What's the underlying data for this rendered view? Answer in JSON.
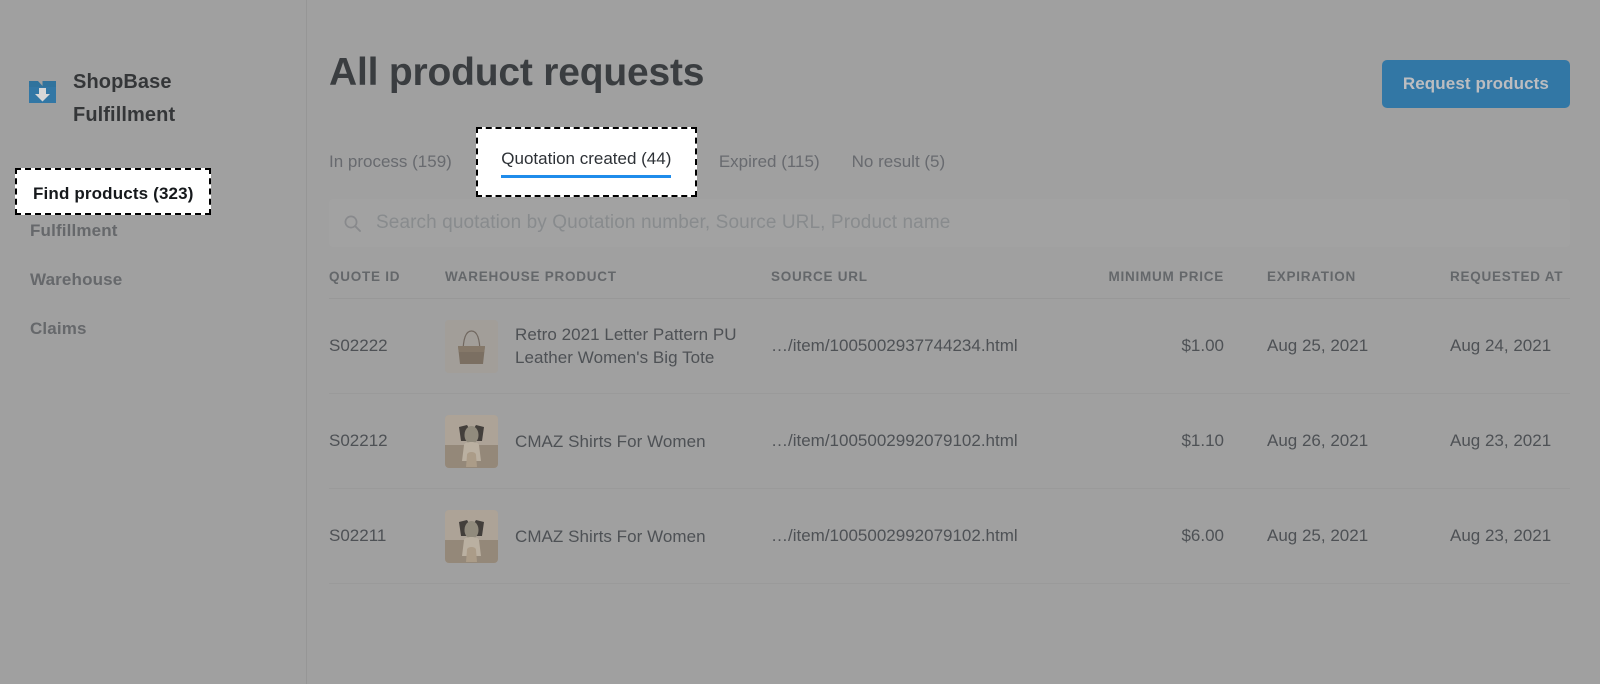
{
  "sidebar": {
    "brand": {
      "logo_icon": "box-download-icon",
      "line1": "ShopBase",
      "line2": "Fulfillment"
    },
    "items": [
      {
        "label": "Find products (323)",
        "active": true
      },
      {
        "label": "Fulfillment",
        "active": false
      },
      {
        "label": "Warehouse",
        "active": false
      },
      {
        "label": "Claims",
        "active": false
      }
    ]
  },
  "header": {
    "title": "All product requests",
    "primary_button": "Request products"
  },
  "tabs": [
    {
      "label": "In process (159)",
      "active": false
    },
    {
      "label": "Quotation created (44)",
      "active": true
    },
    {
      "label": "Expired (115)",
      "active": false
    },
    {
      "label": "No result (5)",
      "active": false
    }
  ],
  "search": {
    "icon": "search-icon",
    "placeholder": "Search quotation by Quotation number, Source URL, Product name",
    "value": ""
  },
  "table": {
    "columns": [
      "QUOTE ID",
      "WAREHOUSE PRODUCT",
      "SOURCE URL",
      "MINIMUM PRICE",
      "EXPIRATION",
      "REQUESTED AT"
    ],
    "rows": [
      {
        "quote_id": "S02222",
        "thumb": "handbag-tote-thumbnail",
        "product": "Retro 2021 Letter Pattern PU Leather Women's Big Tote",
        "source_url": "…/item/1005002937744234.html",
        "minimum_price": "$1.00",
        "expiration": "Aug 25, 2021",
        "requested_at": "Aug 24, 2021"
      },
      {
        "quote_id": "S02212",
        "thumb": "woman-shirt-thumbnail",
        "product": "CMAZ Shirts For Women",
        "source_url": "…/item/1005002992079102.html",
        "minimum_price": "$1.10",
        "expiration": "Aug 26, 2021",
        "requested_at": "Aug 23, 2021"
      },
      {
        "quote_id": "S02211",
        "thumb": "woman-shirt-thumbnail",
        "product": "CMAZ Shirts For Women",
        "source_url": "…/item/1005002992079102.html",
        "minimum_price": "$6.00",
        "expiration": "Aug 25, 2021",
        "requested_at": "Aug 23, 2021"
      }
    ]
  },
  "colors": {
    "brand_blue": "#1476b8",
    "tab_underline": "#1f8ceb",
    "page_background": "#b0b0b0",
    "highlight_border": "#000000",
    "highlight_fill": "#ffffff"
  }
}
